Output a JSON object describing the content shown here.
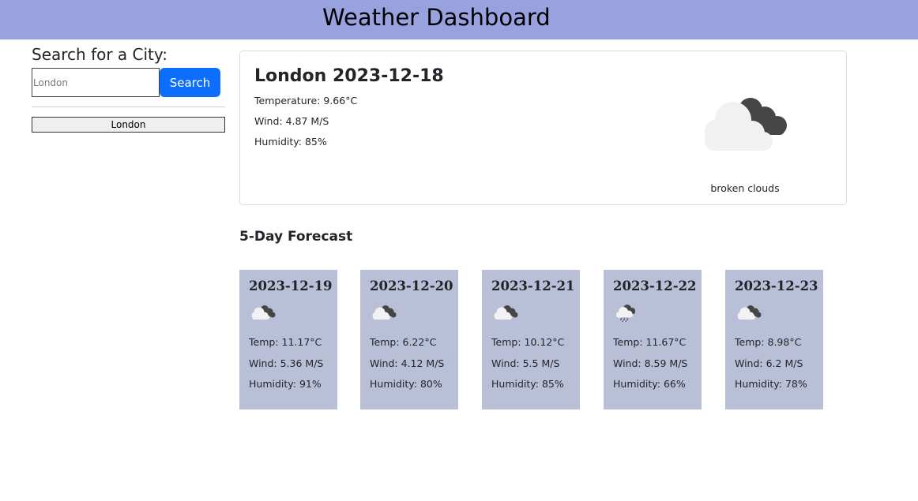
{
  "header": {
    "title": "Weather Dashboard"
  },
  "sidebar": {
    "title": "Search for a City:",
    "search_placeholder": "London",
    "search_value": "",
    "search_button_label": "Search",
    "history": [
      "London"
    ]
  },
  "current": {
    "title": "London 2023-12-18",
    "temperature": "Temperature: 9.66°C",
    "wind": "Wind: 4.87 M/S",
    "humidity": "Humidity: 85%",
    "icon": "broken-clouds-icon",
    "description": "broken clouds"
  },
  "forecast": {
    "heading": "5-Day Forecast",
    "days": [
      {
        "date": "2023-12-19",
        "icon": "broken-clouds-icon",
        "temp": "Temp: 11.17°C",
        "wind": "Wind: 5.36 M/S",
        "humidity": "Humidity: 91%"
      },
      {
        "date": "2023-12-20",
        "icon": "broken-clouds-icon",
        "temp": "Temp: 6.22°C",
        "wind": "Wind: 4.12 M/S",
        "humidity": "Humidity: 80%"
      },
      {
        "date": "2023-12-21",
        "icon": "broken-clouds-icon",
        "temp": "Temp: 10.12°C",
        "wind": "Wind: 5.5 M/S",
        "humidity": "Humidity: 85%"
      },
      {
        "date": "2023-12-22",
        "icon": "rain-cloud-icon",
        "temp": "Temp: 11.67°C",
        "wind": "Wind: 8.59 M/S",
        "humidity": "Humidity: 66%"
      },
      {
        "date": "2023-12-23",
        "icon": "broken-clouds-icon",
        "temp": "Temp: 8.98°C",
        "wind": "Wind: 6.2 M/S",
        "humidity": "Humidity: 78%"
      }
    ]
  },
  "colors": {
    "header_bg": "#97a2df",
    "card_bg": "#babfd8",
    "button_bg": "#0d6efd"
  }
}
